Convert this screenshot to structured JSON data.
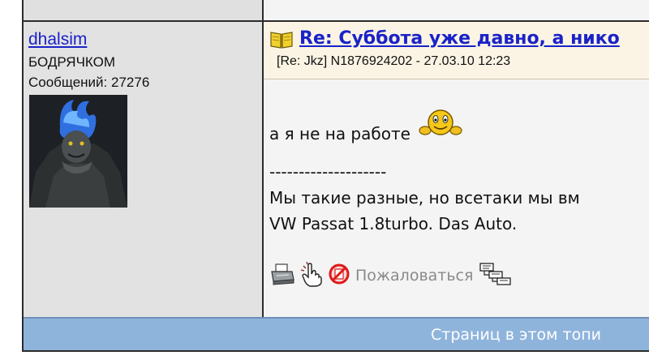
{
  "user": {
    "name": "dhalsim",
    "rank": "БОДРЯЧКОМ",
    "posts_count": "Сообщений: 27276"
  },
  "post": {
    "title": "Re: Суббота уже давно, а нико",
    "meta": "[Re: Jkz]  N1876924202 - 27.03.10 12:23",
    "message": "а я не на работе",
    "signature_separator": "--------------------",
    "signature_line1": "Мы такие разные, но всетаки мы вм",
    "signature_line2": "VW Passat 1.8turbo. Das Auto."
  },
  "actions": {
    "complain_label": "Пожаловаться"
  },
  "footer": {
    "pages_label": "Страниц в этом топи"
  },
  "icons": {
    "title_icon": "open-book-icon",
    "print_icon": "printer-icon",
    "notify_icon": "pointing-hand-icon",
    "complain_icon": "prohibited-icon",
    "thread_icon": "thread-tree-icon",
    "smiley_icon": "smiley-waving-icon"
  },
  "colors": {
    "link": "#1a22c8",
    "user_panel_bg": "#e2e2e2",
    "post_header_bg": "#fbf4e4",
    "pages_bar_bg": "#8fb4dc",
    "muted_text": "#8a8a8a"
  }
}
